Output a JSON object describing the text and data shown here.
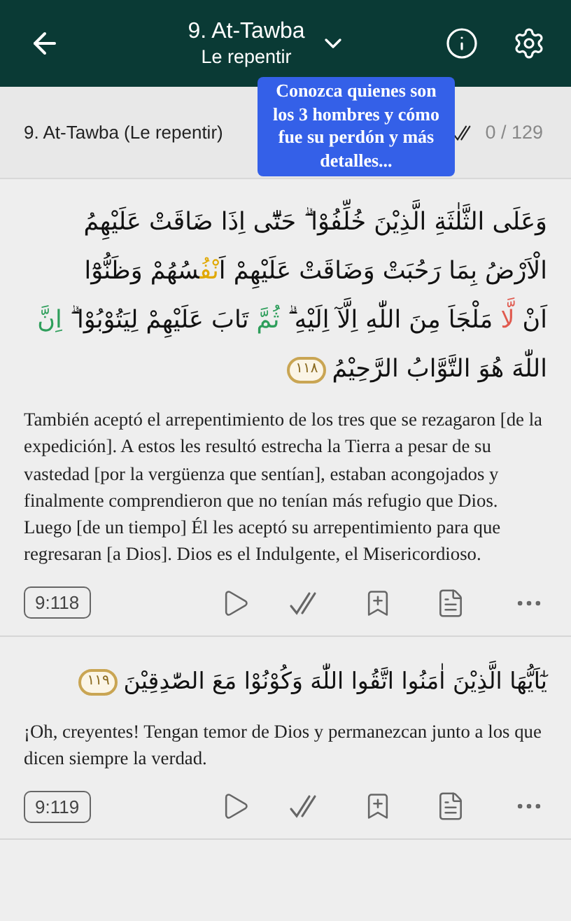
{
  "header": {
    "title": "9. At-Tawba",
    "subtitle": "Le repentir"
  },
  "progress_bar": {
    "surah": "9. At-Tawba (Le repentir)",
    "count": "0 / 129"
  },
  "tooltip": {
    "text": "Conozca quienes son los 3 hombres y cómo fue su perdón y más detalles..."
  },
  "verses": [
    {
      "arabic_lines": [
        [
          {
            "text": "وَعَلَى الثَّلٰثَةِ الَّذِيْنَ خُلِّفُوْا ۗ حَتّٰٓى اِذَا ضَاقَتْ عَلَيْهِمُ"
          }
        ],
        [
          {
            "text": "الْاَرْضُ بِمَا رَحُبَتْ وَضَاقَتْ عَلَيْهِمْ اَ"
          },
          {
            "text": "نْفُ",
            "color": "#e0a800"
          },
          {
            "text": "سُهُمْ وَظَنُّوْٓا"
          }
        ],
        [
          {
            "text": "اَنْ "
          },
          {
            "text": "لَّا",
            "color": "#e05a4f"
          },
          {
            "text": " مَلْجَاَ مِنَ اللّٰهِ اِلَّآ اِلَيْهِ ۗ "
          },
          {
            "text": "ثُمَّ",
            "color": "#2e9e5b"
          },
          {
            "text": " تَابَ عَلَيْهِمْ لِيَتُوْبُوْا ۗ "
          },
          {
            "text": "اِنَّ",
            "color": "#2e9e5b"
          }
        ],
        [
          {
            "text": "اللّٰهَ هُوَ التَّوَّابُ الرَّحِيْمُ"
          }
        ]
      ],
      "marker": "١١٨",
      "translation": "También aceptó el arrepentimiento de los tres que se rezagaron [de la expedición]. A estos les resultó estrecha la Tierra a pesar de su vastedad [por la vergüenza que sentían], estaban acongojados y finalmente comprendieron que no tenían más refugio que Dios. Luego [de un tiempo] Él les aceptó su arrepentimiento para que regresaran [a Dios]. Dios es el Indulgente, el Misericordioso.",
      "reference": "9:118"
    },
    {
      "arabic_lines": [
        [
          {
            "text": "يٰٓاَيُّهَا الَّذِيْنَ اٰمَنُوا اتَّقُوا اللّٰهَ وَكُوْنُوْا مَعَ الصّٰدِقِيْنَ"
          }
        ]
      ],
      "marker": "١١٩",
      "translation": "¡Oh, creyentes! Tengan temor de Dios y permanezcan junto a los que dicen siempre la verdad.",
      "reference": "9:119"
    }
  ]
}
